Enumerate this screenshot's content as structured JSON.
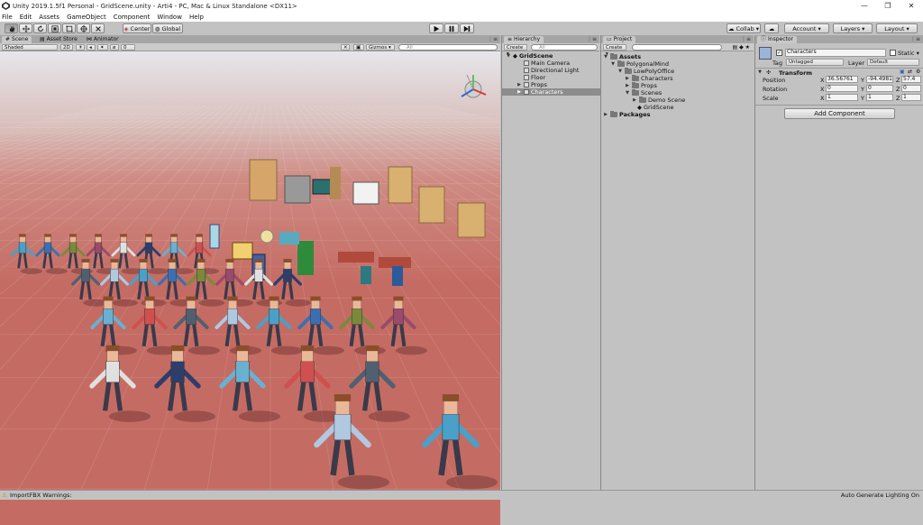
{
  "window": {
    "title": "Unity 2019.1.5f1 Personal - GridScene.unity - Arti4 - PC, Mac & Linux Standalone <DX11>",
    "controls": [
      "—",
      "❐",
      "✕"
    ]
  },
  "menu": [
    "File",
    "Edit",
    "Assets",
    "GameObject",
    "Component",
    "Window",
    "Help"
  ],
  "toolbar": {
    "pivot": "Center",
    "space": "Global",
    "collab": "Collab ▾",
    "account": "Account ▾",
    "layers": "Layers ▾",
    "layout": "Layout ▾"
  },
  "scene": {
    "tabs": [
      "Scene",
      "Asset Store",
      "Animator"
    ],
    "shading": "Shaded",
    "mode2d": "2D",
    "fx_count": "0",
    "gizmos": "Gizmos ▾",
    "search_placeholder": "All"
  },
  "hierarchy": {
    "tab": "Hierarchy",
    "create": "Create ▾",
    "search_placeholder": "All",
    "root": "GridScene",
    "items": [
      {
        "label": "Main Camera",
        "selected": false,
        "expandable": false
      },
      {
        "label": "Directional Light",
        "selected": false,
        "expandable": false
      },
      {
        "label": "Floor",
        "selected": false,
        "expandable": false
      },
      {
        "label": "Props",
        "selected": false,
        "expandable": true
      },
      {
        "label": "Characters",
        "selected": true,
        "expandable": true
      }
    ]
  },
  "project": {
    "tab": "Project",
    "create": "Create ▾",
    "items": [
      {
        "label": "Assets",
        "bold": true
      },
      {
        "label": "PolygonalMind",
        "bold": false
      },
      {
        "label": "LowPolyOffice",
        "bold": false
      },
      {
        "label": "Characters",
        "bold": false
      },
      {
        "label": "Props",
        "bold": false
      },
      {
        "label": "Scenes",
        "bold": false
      },
      {
        "label": "Demo Scene",
        "bold": false
      },
      {
        "label": "GridScene",
        "bold": false
      },
      {
        "label": "Packages",
        "bold": true
      }
    ]
  },
  "inspector": {
    "tab": "Inspector",
    "object_name": "Characters",
    "static_label": "Static ▾",
    "tag_label": "Tag",
    "tag_value": "Untagged",
    "layer_label": "Layer",
    "layer_value": "Default",
    "component": "Transform",
    "position_label": "Position",
    "rotation_label": "Rotation",
    "scale_label": "Scale",
    "position": {
      "x": "36.56761",
      "y": "-94.4981",
      "z": "57.4"
    },
    "rotation": {
      "x": "0",
      "y": "0",
      "z": "0"
    },
    "scale": {
      "x": "1",
      "y": "1",
      "z": "1"
    },
    "add_component": "Add Component"
  },
  "status": {
    "left": "ImportFBX Warnings:",
    "right": "Auto Generate Lighting On"
  },
  "colors": {
    "accent": "#3a72c9",
    "floor": "#c46b63",
    "panel": "#c2c2c2",
    "selection": "#8d8d8d"
  }
}
